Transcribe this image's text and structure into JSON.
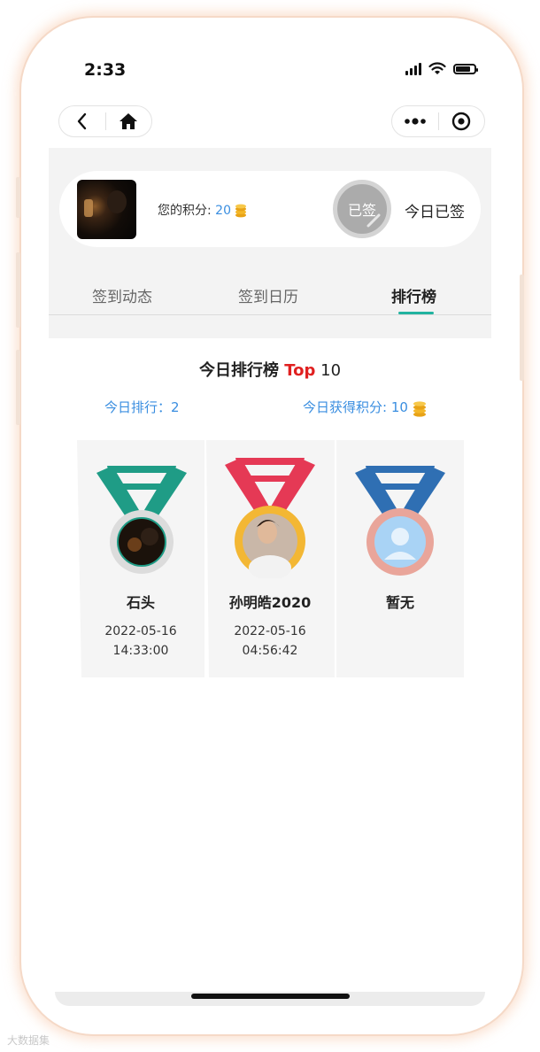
{
  "status": {
    "time": "2:33"
  },
  "profile": {
    "points_label": "您的积分:",
    "points_value": "20",
    "signed_stamp": "已签",
    "signed_text": "今日已签"
  },
  "tabs": [
    {
      "label": "签到动态"
    },
    {
      "label": "签到日历"
    },
    {
      "label": "排行榜",
      "active": true
    }
  ],
  "ranking": {
    "title_prefix": "今日排行榜 ",
    "title_top": "Top",
    "title_count": " 10",
    "today_rank": "今日排行：2",
    "today_points": "今日获得积分: 10"
  },
  "podium": [
    {
      "name": "石头",
      "date": "2022-05-16",
      "time": "14:33:00",
      "ribbon": "#1f9c86",
      "ring": "#dcdcdc"
    },
    {
      "name": "孙明皓2020",
      "date": "2022-05-16",
      "time": "04:56:42",
      "ribbon": "#e53955",
      "ring": "#f3b734"
    },
    {
      "name": "暂无",
      "date": "",
      "time": "",
      "ribbon": "#2f6fb3",
      "ring": "#e9a59a"
    }
  ],
  "watermark": "大数据集"
}
